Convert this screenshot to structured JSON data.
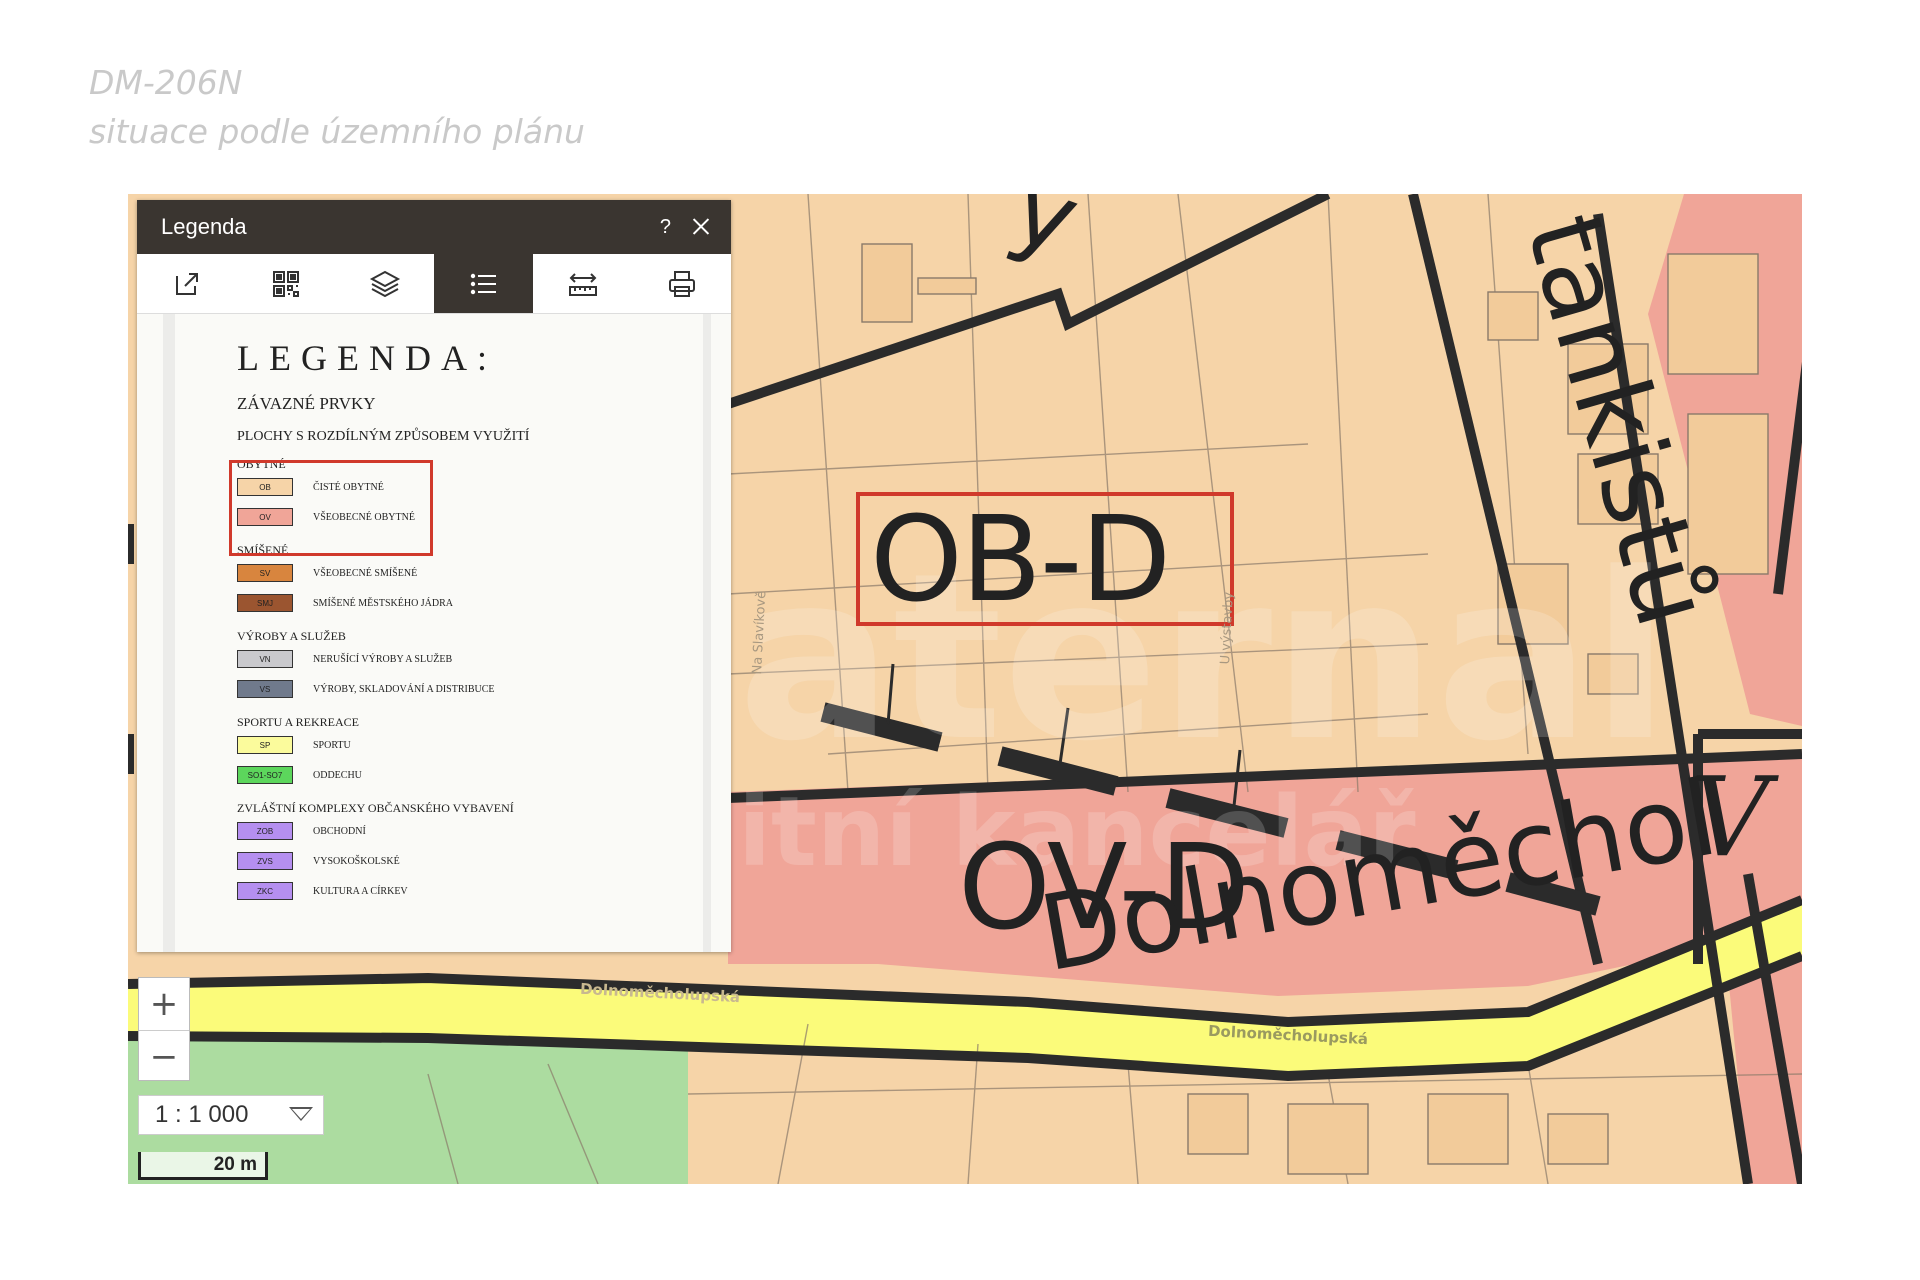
{
  "heading": {
    "line1": "DM-206N",
    "line2": "situace podle územního plánu"
  },
  "map": {
    "zone_labels": {
      "ob_d": "OB-D",
      "ov_d": "OV-D",
      "v": "V"
    },
    "street_labels": {
      "dolnomecholupska_big": "Dolnoměchol",
      "dolnomecholupska_small": "Dolnoměcholupská",
      "dolnomecholupska_small2": "Dolnoměcholupská",
      "tankistu": "tankistů",
      "vystavby": "U výstavby",
      "na_slavikove": "Na Slavíkově",
      "by_fragment": "y"
    },
    "watermark": {
      "line1": "maternal",
      "line2": "realitní kancelář"
    },
    "colors": {
      "ob": "#f6d4a8",
      "ov": "#f0a598",
      "road": "#fbfb7a",
      "park": "#acdca0",
      "highlight": "#d0392b"
    }
  },
  "legend_panel": {
    "title": "Legenda",
    "help": "?",
    "toolbar": [
      {
        "icon": "share-icon"
      },
      {
        "icon": "qr-code-icon"
      },
      {
        "icon": "layers-icon"
      },
      {
        "icon": "list-icon",
        "active": true
      },
      {
        "icon": "measure-icon"
      },
      {
        "icon": "print-icon"
      }
    ],
    "content": {
      "heading": "LEGENDA:",
      "sub": "ZÁVAZNÉ PRVKY",
      "sub2": "PLOCHY S ROZDÍLNÝM ZPŮSOBEM VYUŽITÍ",
      "groups": [
        {
          "name": "OBYTNÉ",
          "items": [
            {
              "code": "OB",
              "label": "ČISTÉ OBYTNÉ",
              "color": "#f6d4a8"
            },
            {
              "code": "OV",
              "label": "VŠEOBECNÉ OBYTNÉ",
              "color": "#f0a598"
            }
          ]
        },
        {
          "name": "SMÍŠENÉ",
          "items": [
            {
              "code": "SV",
              "label": "VŠEOBECNÉ SMÍŠENÉ",
              "color": "#d8853e"
            },
            {
              "code": "SMJ",
              "label": "SMÍŠENÉ MĚSTSKÉHO JÁDRA",
              "color": "#9b5530"
            }
          ]
        },
        {
          "name": "VÝROBY A SLUŽEB",
          "items": [
            {
              "code": "VN",
              "label": "NERUŠÍCÍ VÝROBY A SLUŽEB",
              "color": "#c9c9cd"
            },
            {
              "code": "VS",
              "label": "VÝROBY, SKLADOVÁNÍ A DISTRIBUCE",
              "color": "#707a8c"
            }
          ]
        },
        {
          "name": "SPORTU A REKREACE",
          "items": [
            {
              "code": "SP",
              "label": "SPORTU",
              "color": "#fbfb9c"
            },
            {
              "code": "SO1-SO7",
              "label": "ODDECHU",
              "color": "#5cd65c"
            }
          ]
        },
        {
          "name": "ZVLÁŠTNÍ KOMPLEXY OBČANSKÉHO VYBAVENÍ",
          "items": [
            {
              "code": "ZOB",
              "label": "OBCHODNÍ",
              "color": "#b58ff0"
            },
            {
              "code": "ZVS",
              "label": "VYSOKOŠKOLSKÉ",
              "color": "#b58ff0"
            },
            {
              "code": "ZKC",
              "label": "KULTURA A CÍRKEV",
              "color": "#b58ff0"
            }
          ]
        }
      ]
    }
  },
  "zoom": {
    "in": "+",
    "out": "−"
  },
  "scale": {
    "value": "1 : 1 000",
    "bar_label": "20 m"
  }
}
